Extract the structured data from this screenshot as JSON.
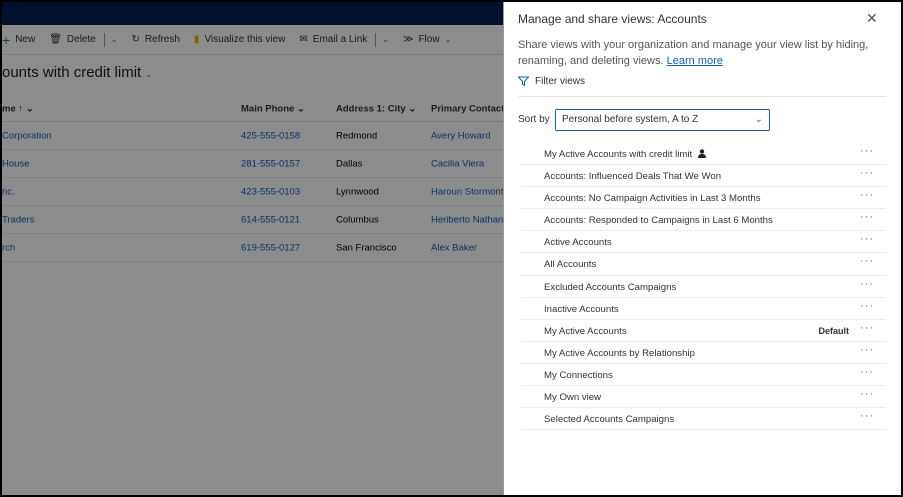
{
  "commandbar": {
    "items": [
      {
        "label": "New",
        "icon": "plus-icon"
      },
      {
        "label": "Delete",
        "icon": "trash-icon"
      },
      {
        "label": "Refresh",
        "icon": "refresh-icon"
      },
      {
        "label": "Visualize this view",
        "icon": "powerbi-icon"
      },
      {
        "label": "Email a Link",
        "icon": "email-icon"
      },
      {
        "label": "Flow",
        "icon": "flow-icon"
      }
    ]
  },
  "view_title": "ounts with credit limit",
  "grid": {
    "columns": [
      "me ↑",
      "Main Phone",
      "Address 1: City",
      "Primary Contact"
    ],
    "rows": [
      [
        "Corporation",
        "425-555-0158",
        "Redmond",
        "Avery Howard"
      ],
      [
        "House",
        "281-555-0157",
        "Dallas",
        "Cacilia Viera"
      ],
      [
        "nc.",
        "423-555-0103",
        "Lynnwood",
        "Haroun Stormont"
      ],
      [
        " Traders",
        "614-555-0121",
        "Columbus",
        "Heriberto Nathan"
      ],
      [
        "rch",
        "619-555-0127",
        "San Francisco",
        "Alex Baker"
      ]
    ]
  },
  "panel": {
    "title": "Manage and share views: Accounts",
    "description": "Share views with your organization and manage your view list by hiding, renaming, and deleting views.",
    "learn_more": "Learn more",
    "filter_label": "Filter views",
    "sort_label": "Sort by",
    "sort_value": "Personal before system, A to Z",
    "views": [
      {
        "name": "My Active Accounts with credit limit",
        "personal": true,
        "badge": ""
      },
      {
        "name": "Accounts: Influenced Deals That We Won",
        "badge": ""
      },
      {
        "name": "Accounts: No Campaign Activities in Last 3 Months",
        "badge": ""
      },
      {
        "name": "Accounts: Responded to Campaigns in Last 6 Months",
        "badge": ""
      },
      {
        "name": "Active Accounts",
        "badge": ""
      },
      {
        "name": "All Accounts",
        "badge": ""
      },
      {
        "name": "Excluded Accounts Campaigns",
        "badge": ""
      },
      {
        "name": "Inactive Accounts",
        "badge": ""
      },
      {
        "name": "My Active Accounts",
        "badge": "Default"
      },
      {
        "name": "My Active Accounts by Relationship",
        "badge": ""
      },
      {
        "name": "My Connections",
        "badge": ""
      },
      {
        "name": "My Own view",
        "badge": ""
      },
      {
        "name": "Selected Accounts Campaigns",
        "badge": ""
      }
    ],
    "more_label": "···"
  },
  "colors": {
    "accent": "#1160b7",
    "topbar": "#002050"
  }
}
